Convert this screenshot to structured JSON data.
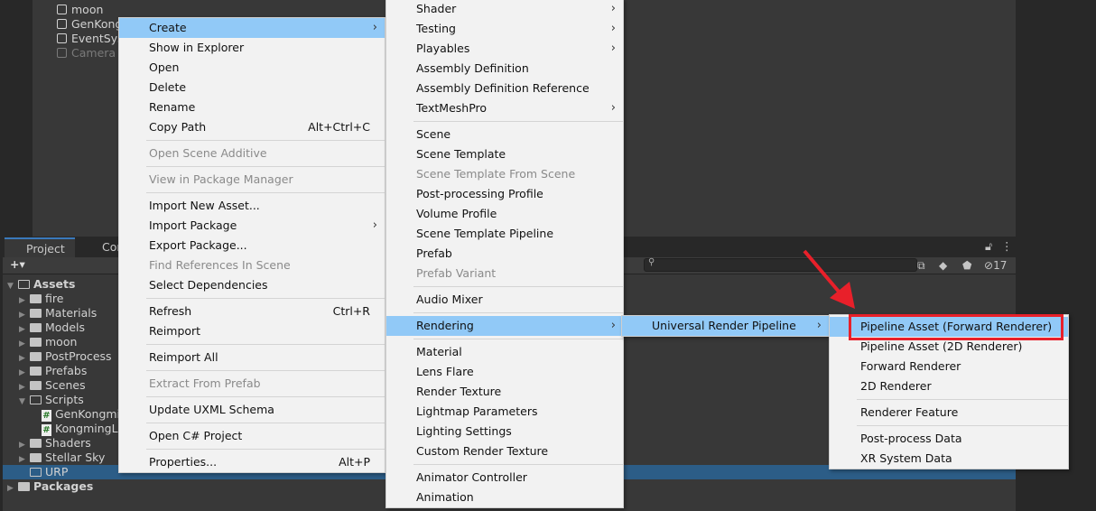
{
  "hierarchy": {
    "items": [
      {
        "label": "moon",
        "dim": false
      },
      {
        "label": "GenKong",
        "dim": false
      },
      {
        "label": "EventSys",
        "dim": false
      },
      {
        "label": "Camera",
        "dim": true
      }
    ]
  },
  "tabs": [
    {
      "label": "Project",
      "icon": "folder-icon"
    },
    {
      "label": "Con",
      "icon": "console-icon"
    }
  ],
  "toolbar": {
    "add_label": "+▾",
    "search_placeholder": "",
    "hidden_count": "17"
  },
  "tree": [
    {
      "label": "Assets",
      "depth": 0,
      "type": "folder-open",
      "arrow": "▼",
      "bold": true
    },
    {
      "label": "fire",
      "depth": 1,
      "type": "folder",
      "arrow": "▶"
    },
    {
      "label": "Materials",
      "depth": 1,
      "type": "folder",
      "arrow": "▶"
    },
    {
      "label": "Models",
      "depth": 1,
      "type": "folder",
      "arrow": "▶"
    },
    {
      "label": "moon",
      "depth": 1,
      "type": "folder",
      "arrow": "▶"
    },
    {
      "label": "PostProcess",
      "depth": 1,
      "type": "folder",
      "arrow": "▶"
    },
    {
      "label": "Prefabs",
      "depth": 1,
      "type": "folder",
      "arrow": "▶"
    },
    {
      "label": "Scenes",
      "depth": 1,
      "type": "folder",
      "arrow": "▶"
    },
    {
      "label": "Scripts",
      "depth": 1,
      "type": "folder-open",
      "arrow": "▼"
    },
    {
      "label": "GenKongmi",
      "depth": 2,
      "type": "script",
      "arrow": ""
    },
    {
      "label": "KongmingLa",
      "depth": 2,
      "type": "script",
      "arrow": ""
    },
    {
      "label": "Shaders",
      "depth": 1,
      "type": "folder",
      "arrow": "▶"
    },
    {
      "label": "Stellar Sky",
      "depth": 1,
      "type": "folder",
      "arrow": "▶"
    },
    {
      "label": "URP",
      "depth": 1,
      "type": "folder-empty",
      "arrow": "",
      "selected": true
    },
    {
      "label": "Packages",
      "depth": 0,
      "type": "folder",
      "arrow": "▶",
      "bold": true
    }
  ],
  "menu_main": [
    {
      "label": "Create",
      "sub": true,
      "hl": true
    },
    {
      "label": "Show in Explorer"
    },
    {
      "label": "Open"
    },
    {
      "label": "Delete"
    },
    {
      "label": "Rename"
    },
    {
      "label": "Copy Path",
      "shortcut": "Alt+Ctrl+C"
    },
    {
      "sep": true
    },
    {
      "label": "Open Scene Additive",
      "dis": true
    },
    {
      "sep": true
    },
    {
      "label": "View in Package Manager",
      "dis": true
    },
    {
      "sep": true
    },
    {
      "label": "Import New Asset..."
    },
    {
      "label": "Import Package",
      "sub": true
    },
    {
      "label": "Export Package..."
    },
    {
      "label": "Find References In Scene",
      "dis": true
    },
    {
      "label": "Select Dependencies"
    },
    {
      "sep": true
    },
    {
      "label": "Refresh",
      "shortcut": "Ctrl+R"
    },
    {
      "label": "Reimport"
    },
    {
      "sep": true
    },
    {
      "label": "Reimport All"
    },
    {
      "sep": true
    },
    {
      "label": "Extract From Prefab",
      "dis": true
    },
    {
      "sep": true
    },
    {
      "label": "Update UXML Schema"
    },
    {
      "sep": true
    },
    {
      "label": "Open C# Project"
    },
    {
      "sep": true
    },
    {
      "label": "Properties...",
      "shortcut": "Alt+P"
    }
  ],
  "menu_create": [
    {
      "label": "Shader",
      "sub": true
    },
    {
      "label": "Testing",
      "sub": true
    },
    {
      "label": "Playables",
      "sub": true
    },
    {
      "label": "Assembly Definition"
    },
    {
      "label": "Assembly Definition Reference"
    },
    {
      "label": "TextMeshPro",
      "sub": true
    },
    {
      "sep": true
    },
    {
      "label": "Scene"
    },
    {
      "label": "Scene Template"
    },
    {
      "label": "Scene Template From Scene",
      "dis": true
    },
    {
      "label": "Post-processing Profile"
    },
    {
      "label": "Volume Profile"
    },
    {
      "label": "Scene Template Pipeline"
    },
    {
      "label": "Prefab"
    },
    {
      "label": "Prefab Variant",
      "dis": true
    },
    {
      "sep": true
    },
    {
      "label": "Audio Mixer"
    },
    {
      "sep": true
    },
    {
      "label": "Rendering",
      "sub": true,
      "hl": true
    },
    {
      "sep": true
    },
    {
      "label": "Material"
    },
    {
      "label": "Lens Flare"
    },
    {
      "label": "Render Texture"
    },
    {
      "label": "Lightmap Parameters"
    },
    {
      "label": "Lighting Settings"
    },
    {
      "label": "Custom Render Texture"
    },
    {
      "sep": true
    },
    {
      "label": "Animator Controller"
    },
    {
      "label": "Animation"
    }
  ],
  "menu_rendering": [
    {
      "label": "Universal Render Pipeline",
      "sub": true,
      "hl": true
    }
  ],
  "menu_urp": [
    {
      "label": "Pipeline Asset (Forward Renderer)",
      "hl": true
    },
    {
      "label": "Pipeline Asset (2D Renderer)"
    },
    {
      "label": "Forward Renderer"
    },
    {
      "label": "2D Renderer"
    },
    {
      "sep": true
    },
    {
      "label": "Renderer Feature"
    },
    {
      "sep": true
    },
    {
      "label": "Post-process Data"
    },
    {
      "label": "XR System Data"
    }
  ],
  "annotation": {
    "color": "#e8202a",
    "target": "Pipeline Asset (Forward Renderer)"
  },
  "colors": {
    "highlight": "#91c9f7",
    "selection": "#2c5d87",
    "menu_bg": "#f2f2f2"
  }
}
